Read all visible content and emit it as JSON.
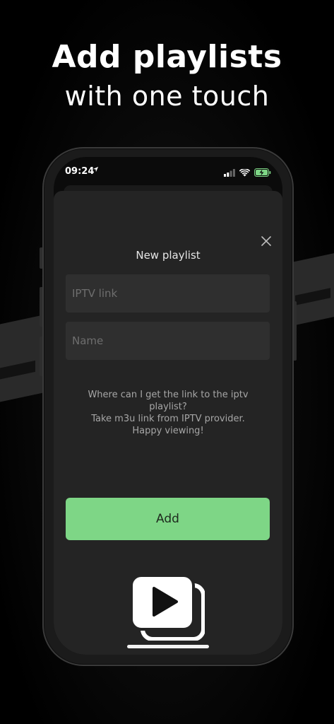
{
  "headline": {
    "line1": "Add playlists",
    "line2": "with one touch"
  },
  "status_bar": {
    "time": "09:24",
    "location_icon": "location-arrow-icon",
    "signal_icon": "cellular-signal-icon",
    "wifi_icon": "wifi-icon",
    "battery_icon": "battery-charging-icon"
  },
  "sheet": {
    "title": "New playlist",
    "close_icon": "close-icon",
    "iptv_link_placeholder": "IPTV link",
    "iptv_link_value": "",
    "name_placeholder": "Name",
    "name_value": "",
    "help_line1": "Where can I get the link to the iptv playlist?",
    "help_line2": "Take m3u link from IPTV provider.",
    "help_line3": "Happy viewing!",
    "add_label": "Add",
    "logo_icon": "stacked-play-icon"
  },
  "colors": {
    "background": "#000000",
    "sheet": "#242424",
    "field": "#2f2f2f",
    "accent": "#7ed686",
    "battery": "#7ed686"
  }
}
